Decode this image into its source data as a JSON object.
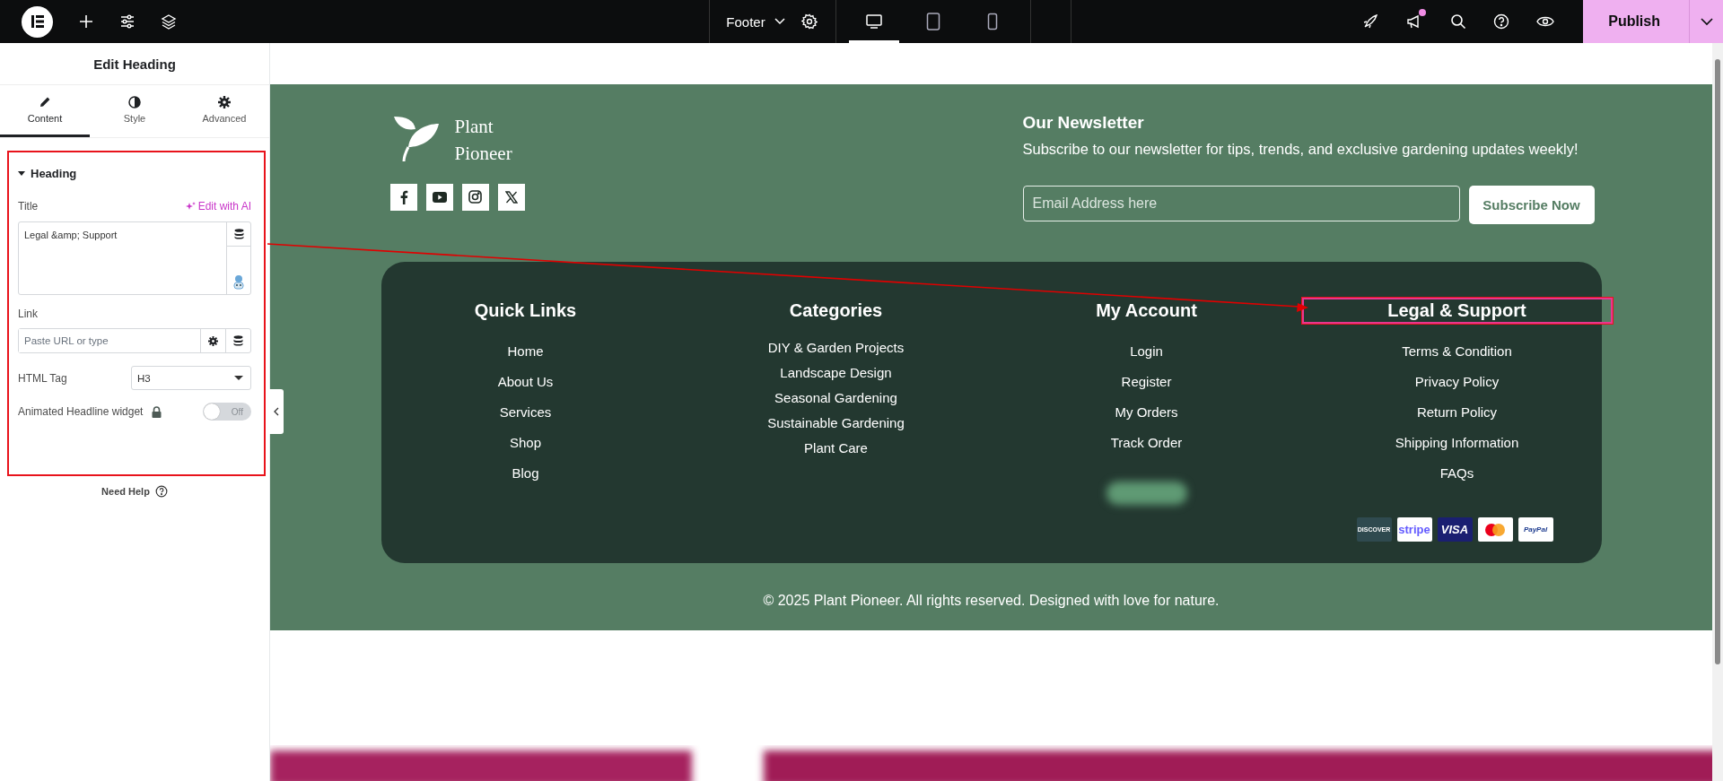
{
  "top_bar": {
    "document": "Footer",
    "devices": [
      {
        "kind": "desktop",
        "selected": true
      },
      {
        "kind": "tablet",
        "selected": false
      },
      {
        "kind": "mobile",
        "selected": false
      }
    ],
    "notification": true,
    "publish": "Publish"
  },
  "panel": {
    "title": "Edit Heading",
    "tabs": [
      {
        "kind": "content",
        "label": "Content",
        "selected": true
      },
      {
        "kind": "style",
        "label": "Style",
        "selected": false
      },
      {
        "kind": "advanced",
        "label": "Advanced",
        "selected": false
      }
    ],
    "section": {
      "title": "Heading",
      "expanded": true
    },
    "title_label": "Title",
    "ai_link": "Edit with AI",
    "title_value": "Legal &amp; Support",
    "link_label": "Link",
    "link_placeholder": "Paste URL or type",
    "html_tag_label": "HTML Tag",
    "html_tag_value": "H3",
    "animated_label": "Animated Headline widget",
    "animated_toggle": {
      "on": false,
      "text": "Off"
    },
    "need_help": "Need Help"
  },
  "footer": {
    "brand": [
      "Plant",
      "Pioneer"
    ],
    "socials": [
      {
        "kind": "facebook"
      },
      {
        "kind": "youtube"
      },
      {
        "kind": "instagram"
      },
      {
        "kind": "x"
      }
    ],
    "newsletter": {
      "title": "Our Newsletter",
      "text": "Subscribe to our newsletter for tips, trends, and exclusive gardening updates weekly!",
      "placeholder": "Email Address here",
      "button": "Subscribe Now"
    },
    "columns": [
      {
        "heading": "Quick Links",
        "selected": false,
        "dense": false,
        "links": [
          "Home",
          "About Us",
          "Services",
          "Shop",
          "Blog"
        ]
      },
      {
        "heading": "Categories",
        "selected": false,
        "dense": true,
        "links": [
          "DIY & Garden Projects",
          "Landscape Design",
          "Seasonal Gardening",
          "Sustainable Gardening",
          "Plant Care"
        ]
      },
      {
        "heading": "My Account",
        "selected": false,
        "dense": false,
        "links": [
          "Login",
          "Register",
          "My Orders",
          "Track Order"
        ]
      },
      {
        "heading": "Legal & Support",
        "selected": true,
        "dense": false,
        "links": [
          "Terms & Condition",
          "Privacy Policy",
          "Return Policy",
          "Shipping Information",
          "FAQs"
        ]
      }
    ],
    "payments": [
      {
        "kind": "discover",
        "label": "DISCOVER"
      },
      {
        "kind": "stripe",
        "label": "stripe"
      },
      {
        "kind": "visa",
        "label": "VISA"
      },
      {
        "kind": "mastercard"
      },
      {
        "kind": "paypal",
        "label": "PayPal"
      }
    ],
    "copyright": "© 2025 Plant Pioneer. All rights reserved. Designed with love for nature."
  }
}
